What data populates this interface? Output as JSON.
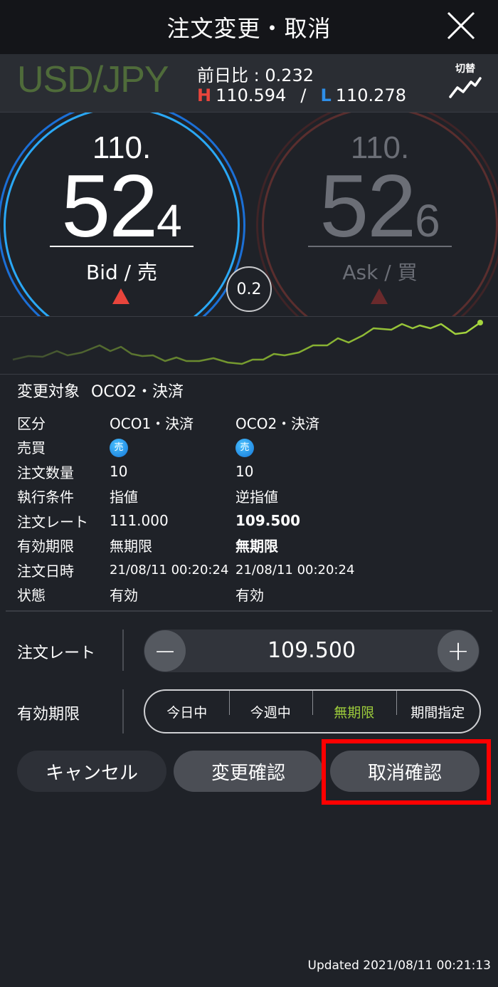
{
  "header": {
    "title": "注文変更・取消",
    "close_icon": "close-icon"
  },
  "summary": {
    "pair": "USD/JPY",
    "prev_diff": "前日比 : 0.232",
    "high_label": "H",
    "high_value": "110.594",
    "separator": "/",
    "low_label": "L",
    "low_value": "110.278",
    "switch_label": "切替",
    "switch_icon": "line-chart-icon"
  },
  "quotes": {
    "bid": {
      "prefix": "110.",
      "big": "52",
      "small": "4",
      "label": "Bid / 売",
      "arrow_icon": "up-triangle-icon",
      "color": "#2aa8f5"
    },
    "ask": {
      "prefix": "110.",
      "big": "52",
      "small": "6",
      "label": "Ask / 買",
      "arrow_icon": "up-triangle-icon",
      "color": "#6a2a2c"
    },
    "spread": "0.2"
  },
  "order": {
    "target_label": "変更対象",
    "target_value": "OCO2・決済",
    "rows": [
      {
        "label": "区分",
        "oco1": "OCO1・決済",
        "oco2": "OCO2・決済"
      },
      {
        "label": "売買",
        "oco1": "売",
        "oco2": "売"
      },
      {
        "label": "注文数量",
        "oco1": "10",
        "oco2": "10"
      },
      {
        "label": "執行条件",
        "oco1": "指値",
        "oco2": "逆指値"
      },
      {
        "label": "注文レート",
        "oco1": "111.000",
        "oco2": "109.500"
      },
      {
        "label": "有効期限",
        "oco1": "無期限",
        "oco2": "無期限"
      },
      {
        "label": "注文日時",
        "oco1": "21/08/11 00:20:24",
        "oco2": "21/08/11 00:20:24"
      },
      {
        "label": "状態",
        "oco1": "有効",
        "oco2": "有効"
      }
    ]
  },
  "form": {
    "rate_label": "注文レート",
    "rate_value": "109.500",
    "minus": "−",
    "plus": "+",
    "expiry_label": "有効期限",
    "expiry_options": [
      "今日中",
      "今週中",
      "無期限",
      "期間指定"
    ],
    "expiry_selected": "無期限"
  },
  "buttons": {
    "cancel": "キャンセル",
    "change": "変更確認",
    "delete": "取消確認"
  },
  "updated": "Updated  2021/08/11 00:21:13",
  "colors": {
    "background": "#1f2228",
    "accent_green": "#9ccb3b",
    "bid_blue": "#2aa8f5",
    "high_red": "#e8453c",
    "low_blue": "#2e8ee8",
    "highlight_red": "#ff0000"
  }
}
